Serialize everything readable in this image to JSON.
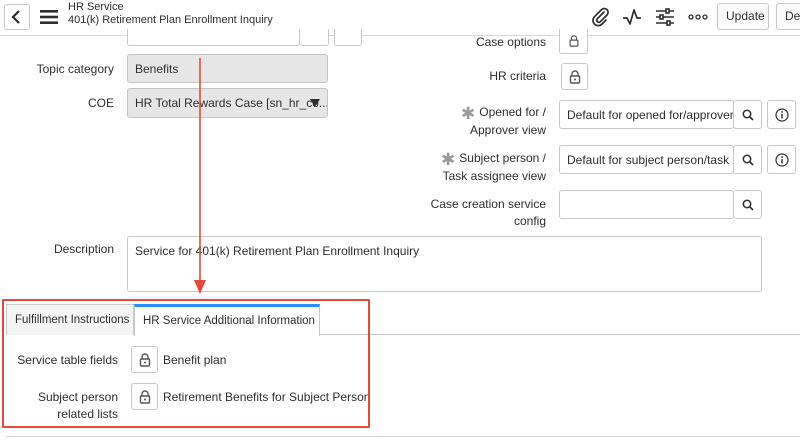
{
  "header": {
    "record_type": "HR Service",
    "record_name": "401(k) Retirement Plan Enrollment Inquiry",
    "icons": [
      "back-icon",
      "hamburger-menu-icon",
      "paperclip-icon",
      "activity-pulse-icon",
      "sliders-icon",
      "more-options-icon"
    ],
    "update_label": "Update",
    "delete_label": "Delete"
  },
  "form": {
    "case_options_label": "Case options",
    "topic_category_label": "Topic category",
    "topic_category_value": "Benefits",
    "coe_label": "COE",
    "coe_value": "HR Total Rewards Case [sn_hr_co...",
    "hr_criteria_label": "HR criteria",
    "opened_for_label_1": "Opened for /",
    "opened_for_label_2": "Approver view",
    "opened_for_value": "Default for opened for/approver",
    "subject_person_label_1": "Subject person /",
    "subject_person_label_2": "Task assignee view",
    "subject_person_value": "Default for subject person/task a",
    "case_creation_label_1": "Case creation service",
    "case_creation_label_2": "config",
    "case_creation_value": "",
    "description_label": "Description",
    "description_value": "Service for 401(k) Retirement Plan Enrollment Inquiry"
  },
  "tabs": [
    {
      "label": "Fulfillment Instructions",
      "active": false
    },
    {
      "label": "HR Service Additional Information",
      "active": true
    }
  ],
  "tab_content": {
    "service_table_fields_label": "Service table fields",
    "service_table_fields_value": "Benefit plan",
    "subject_related_label_1": "Subject person",
    "subject_related_label_2": "related lists",
    "subject_related_value": "Retirement Benefits for Subject Person"
  },
  "colors": {
    "accent": "#278efc",
    "annotation_red": "#e8473b",
    "readonly_bg": "#e6e6e6"
  }
}
